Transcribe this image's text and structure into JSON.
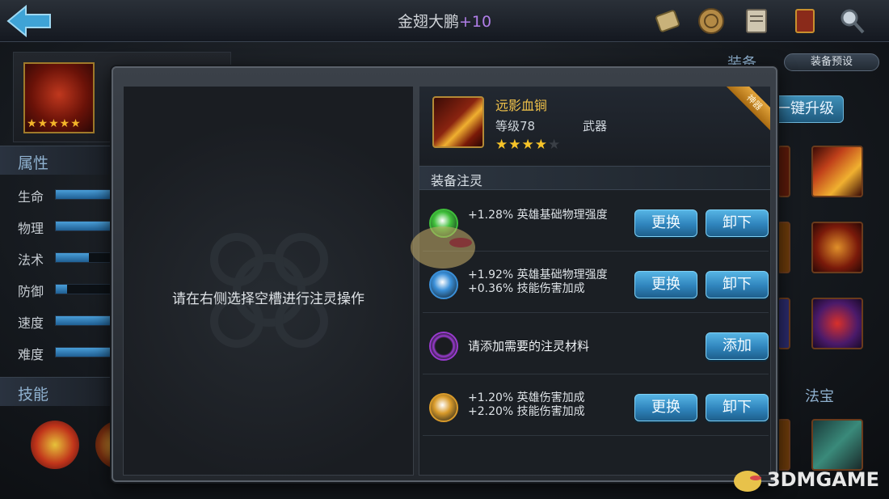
{
  "topbar": {
    "title": "金翅大鹏",
    "title_suffix": "+10",
    "icons": [
      "scroll-icon",
      "coin-icon",
      "map-icon",
      "book-icon",
      "magnifier-icon"
    ]
  },
  "hero": {
    "stars": "★★★★★"
  },
  "sidebar": {
    "attributes_title": "属性",
    "stats": [
      {
        "label": "生命",
        "level": 0.8
      },
      {
        "label": "物理",
        "level": 0.8
      },
      {
        "label": "法术",
        "level": 0.45
      },
      {
        "label": "防御",
        "level": 0.15
      },
      {
        "label": "速度",
        "level": 0.8
      },
      {
        "label": "难度",
        "level": 0.8
      }
    ],
    "skills_title": "技能"
  },
  "right_bg": {
    "equip_label": "装备",
    "equip_preset": "装备预设",
    "upgrade_button": "一键升级",
    "fabao_label": "法宝"
  },
  "modal": {
    "left_hint": "请在右侧选择空槽进行注灵操作",
    "item": {
      "name": "远影血锏",
      "level": "等级78",
      "type": "武器",
      "stars_filled": 4,
      "stars_total": 5,
      "quality_badge": "神器"
    },
    "section_title": "装备注灵",
    "slots": [
      {
        "orb_color": "#3fbf3a",
        "lines": [
          "+1.28% 英雄基础物理强度"
        ],
        "buttons": [
          "更换",
          "卸下"
        ]
      },
      {
        "orb_color": "#3a8fd8",
        "lines": [
          "+1.92% 英雄基础物理强度",
          "+0.36% 技能伤害加成"
        ],
        "buttons": [
          "更换",
          "卸下"
        ]
      },
      {
        "orb_color": "#9a3ad0",
        "single": "请添加需要的注灵材料",
        "buttons": [
          "添加"
        ]
      },
      {
        "orb_color": "#d89a2a",
        "lines": [
          "+1.20% 英雄伤害加成",
          "+2.20% 技能伤害加成"
        ],
        "buttons": [
          "更换",
          "卸下"
        ]
      }
    ]
  },
  "watermark": {
    "text": "3DMGAME"
  }
}
